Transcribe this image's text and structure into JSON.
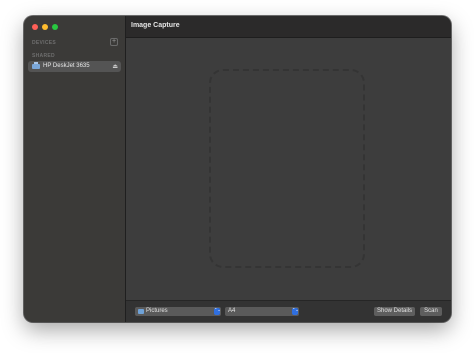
{
  "window": {
    "title": "Image Capture"
  },
  "sidebar": {
    "devices_header": "DEVICES",
    "add_symbol": "+",
    "shared_header": "SHARED",
    "items": [
      {
        "label": "HP DeskJet 3635",
        "icon": "printer-icon",
        "accessory_icon": "eject-icon",
        "eject_symbol": "⏏"
      }
    ]
  },
  "toolbar": {
    "destination": {
      "value": "Pictures",
      "icon": "folder-icon",
      "chevron": "⌃⌄"
    },
    "size": {
      "value": "A4",
      "chevron": "⌃⌄"
    },
    "show_details_label": "Show Details",
    "scan_label": "Scan"
  },
  "colors": {
    "accent": "#2f6fe0",
    "close": "#ff5f57",
    "minimize": "#febc2e",
    "zoom": "#28c840"
  }
}
